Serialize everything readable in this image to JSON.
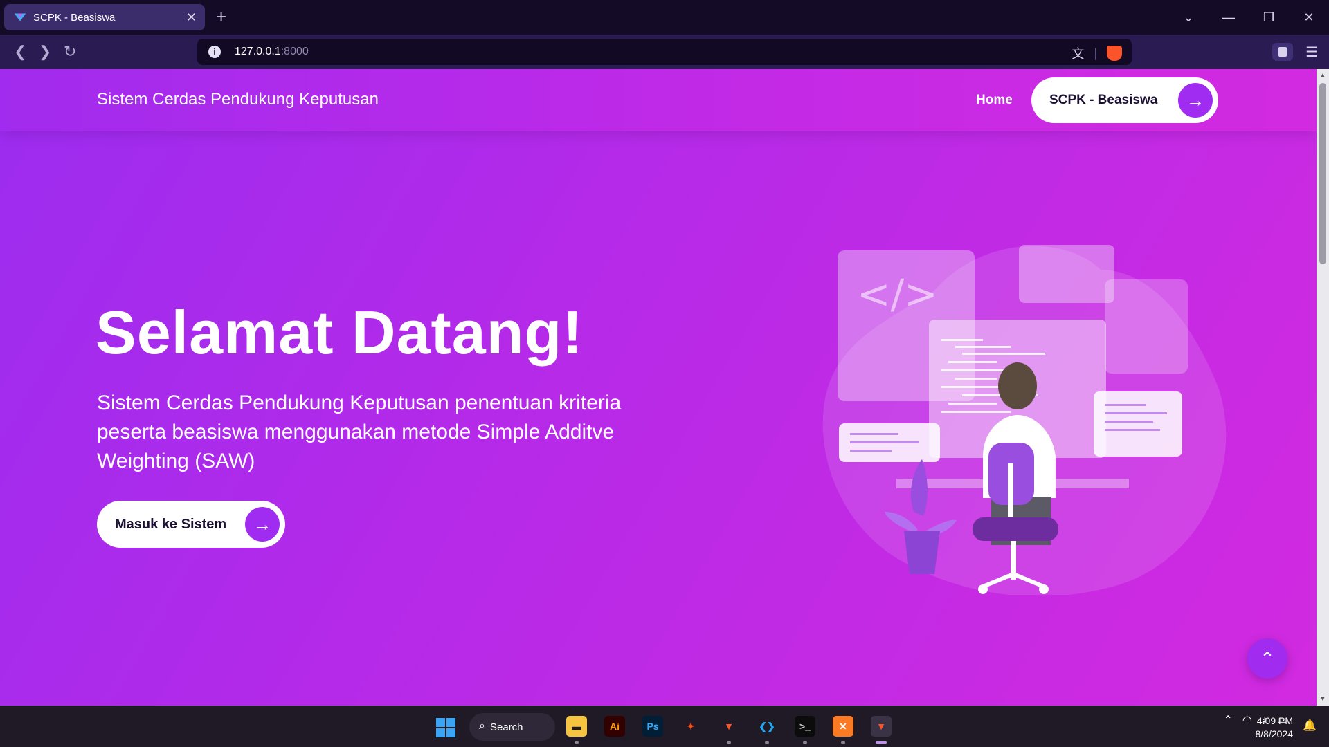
{
  "browser": {
    "tab_title": "SCPK - Beasiswa",
    "url_host": "127.0.0.1",
    "url_port": ":8000"
  },
  "site": {
    "brand": "Sistem Cerdas Pendukung Keputusan",
    "nav_home": "Home",
    "header_cta": "SCPK - Beasiswa"
  },
  "hero": {
    "title": "Selamat Datang!",
    "subtitle": "Sistem Cerdas Pendukung Keputusan penentuan kriteria peserta beasiswa menggunakan metode Simple Additve Weighting (SAW)",
    "cta": "Masuk ke Sistem"
  },
  "illustration": {
    "code_tag": "</>"
  },
  "taskbar": {
    "search_label": "Search",
    "apps": [
      {
        "name": "file-explorer-icon",
        "glyph": "▬",
        "bg": "#f5c542",
        "fg": "#1f1a26"
      },
      {
        "name": "illustrator-icon",
        "glyph": "Ai",
        "bg": "#330000",
        "fg": "#ff9a00"
      },
      {
        "name": "photoshop-icon",
        "glyph": "Ps",
        "bg": "#001e36",
        "fg": "#31a8ff"
      },
      {
        "name": "figma-icon",
        "glyph": "✦",
        "bg": "#1f1a26",
        "fg": "#f24e1e"
      },
      {
        "name": "brave-beta-icon",
        "glyph": "▼",
        "bg": "#1f1a26",
        "fg": "#fb542b"
      },
      {
        "name": "vscode-icon",
        "glyph": "❮❯",
        "bg": "#1f1a26",
        "fg": "#23a9f2"
      },
      {
        "name": "terminal-icon",
        "glyph": ">_",
        "bg": "#0c0c0c",
        "fg": "#cccccc"
      },
      {
        "name": "xampp-icon",
        "glyph": "✕",
        "bg": "#fb7a24",
        "fg": "#ffffff"
      },
      {
        "name": "brave-icon",
        "glyph": "▼",
        "bg": "#3a3345",
        "fg": "#fb542b"
      }
    ],
    "time": "4:09 PM",
    "date": "8/8/2024"
  },
  "colors": {
    "accent": "#9f2cf0",
    "gradient_start": "#9c2cf0",
    "gradient_end": "#d22ae0"
  }
}
